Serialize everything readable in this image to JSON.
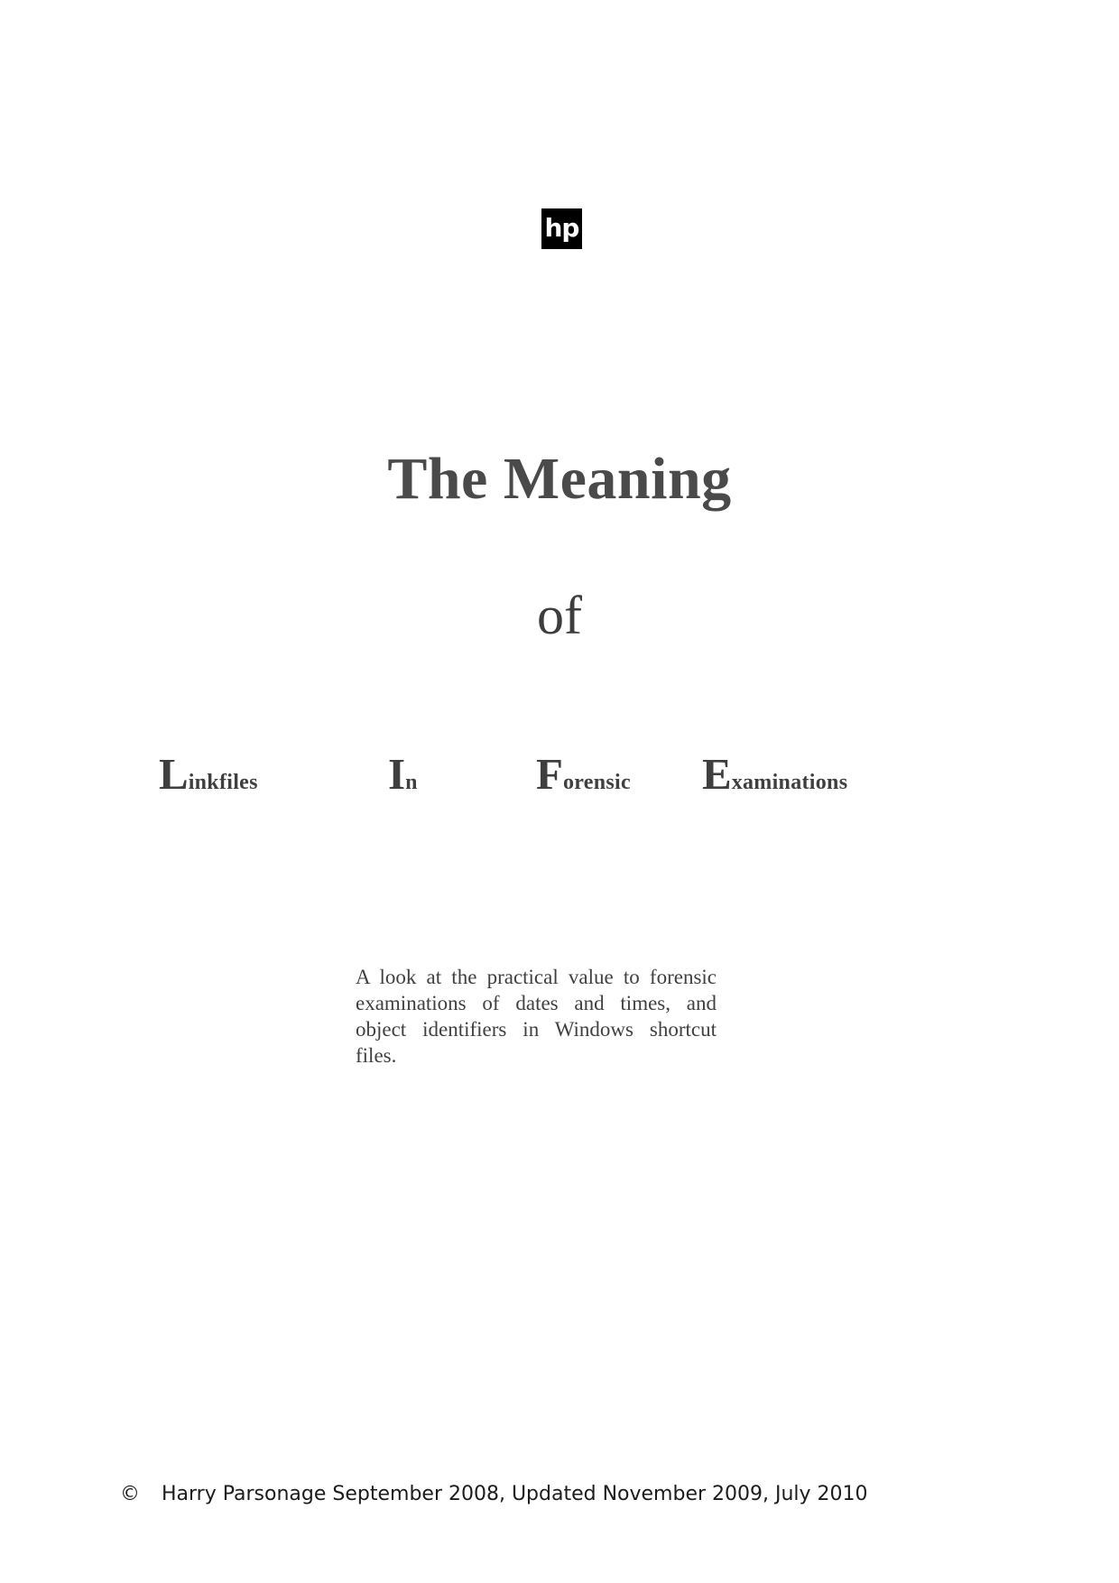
{
  "document": {
    "kind": "title-page",
    "background_color": "#ffffff",
    "text_color": "#404040"
  },
  "logo": {
    "name": "hp-logo",
    "text": "hp",
    "background_color": "#000000",
    "text_color": "#ffffff"
  },
  "title": {
    "line1": "The Meaning",
    "line2": "of"
  },
  "acronym": {
    "words": [
      {
        "cap": "L",
        "rest": "inkfiles"
      },
      {
        "cap": "I",
        "rest": "n"
      },
      {
        "cap": "F",
        "rest": "orensic"
      },
      {
        "cap": "E",
        "rest": "xaminations"
      }
    ]
  },
  "abstract": {
    "text": "A look at the practical value to forensic examinations of dates and times, and object identifiers in Windows shortcut files."
  },
  "footer": {
    "copyright_symbol": "©",
    "text": "Harry Parsonage September 2008, Updated November 2009, July 2010"
  }
}
